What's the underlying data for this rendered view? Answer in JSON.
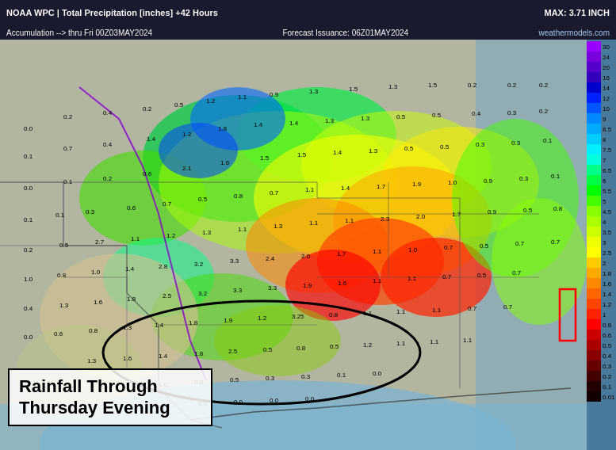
{
  "header": {
    "title": "NOAA WPC | Total Precipitation [inches] +42 Hours",
    "accumulation": "Accumulation --> thru Fri 00Z03MAY2024",
    "forecast": "Forecast Issuance: 06Z01MAY2024",
    "max_value": "MAX: 3.71 INCH",
    "watermark": "weathermodels.com"
  },
  "rainfall_label": "Rainfall Through Thursday Evening",
  "legend": {
    "values": [
      "30",
      "24",
      "20",
      "16",
      "14",
      "12",
      "10",
      "9",
      "8.5",
      "8",
      "7.5",
      "7",
      "6.5",
      "6",
      "5.5",
      "5",
      "4.5",
      "4",
      "3.5",
      "3",
      "2.5",
      "2",
      "1.8",
      "1.6",
      "1.4",
      "1.2",
      "1",
      "0.8",
      "0.6",
      "0.5",
      "0.4",
      "0.3",
      "0.2",
      "0.1",
      "0.01"
    ],
    "colors": [
      "#6600cc",
      "#7700dd",
      "#8800ee",
      "#5500bb",
      "#4400aa",
      "#3300aa",
      "#0000ff",
      "#0022ff",
      "#0055ff",
      "#0077ff",
      "#00aaff",
      "#00ccff",
      "#00eeff",
      "#00ff88",
      "#00ff44",
      "#00ff00",
      "#44ff00",
      "#88ff00",
      "#aaff00",
      "#ccff00",
      "#ffff00",
      "#ffcc00",
      "#ffaa00",
      "#ff8800",
      "#ff6600",
      "#ff4400",
      "#ff2200",
      "#ff0000",
      "#cc0000",
      "#aa0000",
      "#880000",
      "#660000",
      "#440000",
      "#220000",
      "#110000"
    ]
  },
  "map": {
    "data_points": [
      "0.0",
      "0.2",
      "0.4",
      "0.2",
      "0.5",
      "1.2",
      "1.1",
      "0.9",
      "1.3",
      "1.5",
      "0.1",
      "0.7",
      "0.4",
      "1.2",
      "1.2",
      "1.8",
      "1.4",
      "1.3",
      "1.5",
      "1.3",
      "0.0",
      "0.3",
      "0.8",
      "1.0",
      "1.3",
      "1.4",
      "1.3",
      "1.4",
      "1.3",
      "1.0",
      "0.1",
      "0.6",
      "0.7",
      "1.5",
      "1.5",
      "1.0",
      "1.1",
      "1.4",
      "1.7",
      "0.9",
      "0.2",
      "0.4",
      "1.6",
      "0.9",
      "0.7",
      "1.5",
      "1.1",
      "1.9",
      "2.3",
      "2.0",
      "1.0",
      "0.8",
      "1.0",
      "1.4",
      "2.8",
      "3.2",
      "3.3",
      "2.5",
      "1.7",
      "1.1",
      "0.4",
      "1.3",
      "1.6",
      "1.8",
      "2.5",
      "3.2",
      "3.3",
      "3.3",
      "1.9",
      "0.7",
      "0.6",
      "0.8",
      "1.3",
      "1.6",
      "2.5",
      "0.8",
      "0.5",
      "0.3",
      "0.3",
      "0.1"
    ]
  }
}
